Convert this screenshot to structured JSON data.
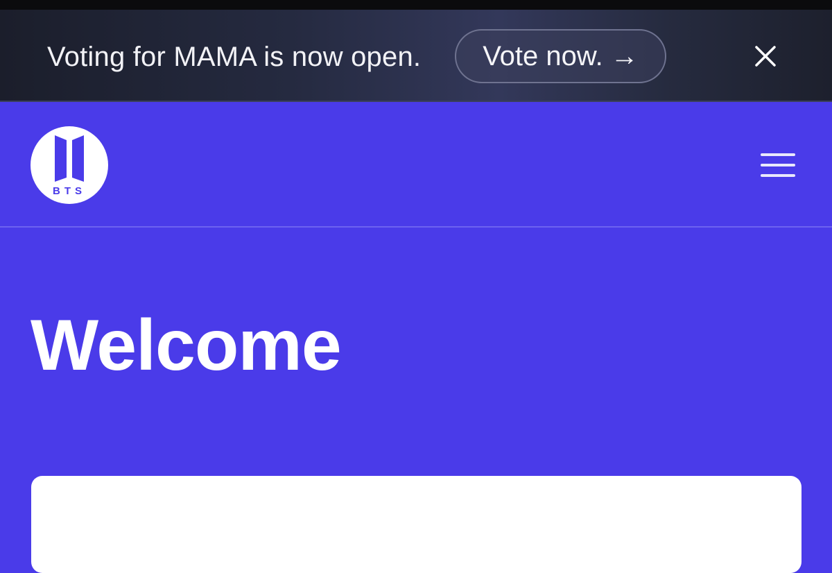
{
  "banner": {
    "message": "Voting for MAMA is now open.",
    "cta_label": "Vote now. →",
    "close_icon": "close-icon"
  },
  "header": {
    "logo_text": "BTS",
    "logo_icon": "bts-logo",
    "menu_icon": "hamburger-menu-icon"
  },
  "main": {
    "title": "Welcome"
  },
  "colors": {
    "page_background": "#4a3be9",
    "banner_background": "#252a40",
    "logo_accent": "#4a3be9",
    "text": "#ffffff"
  }
}
